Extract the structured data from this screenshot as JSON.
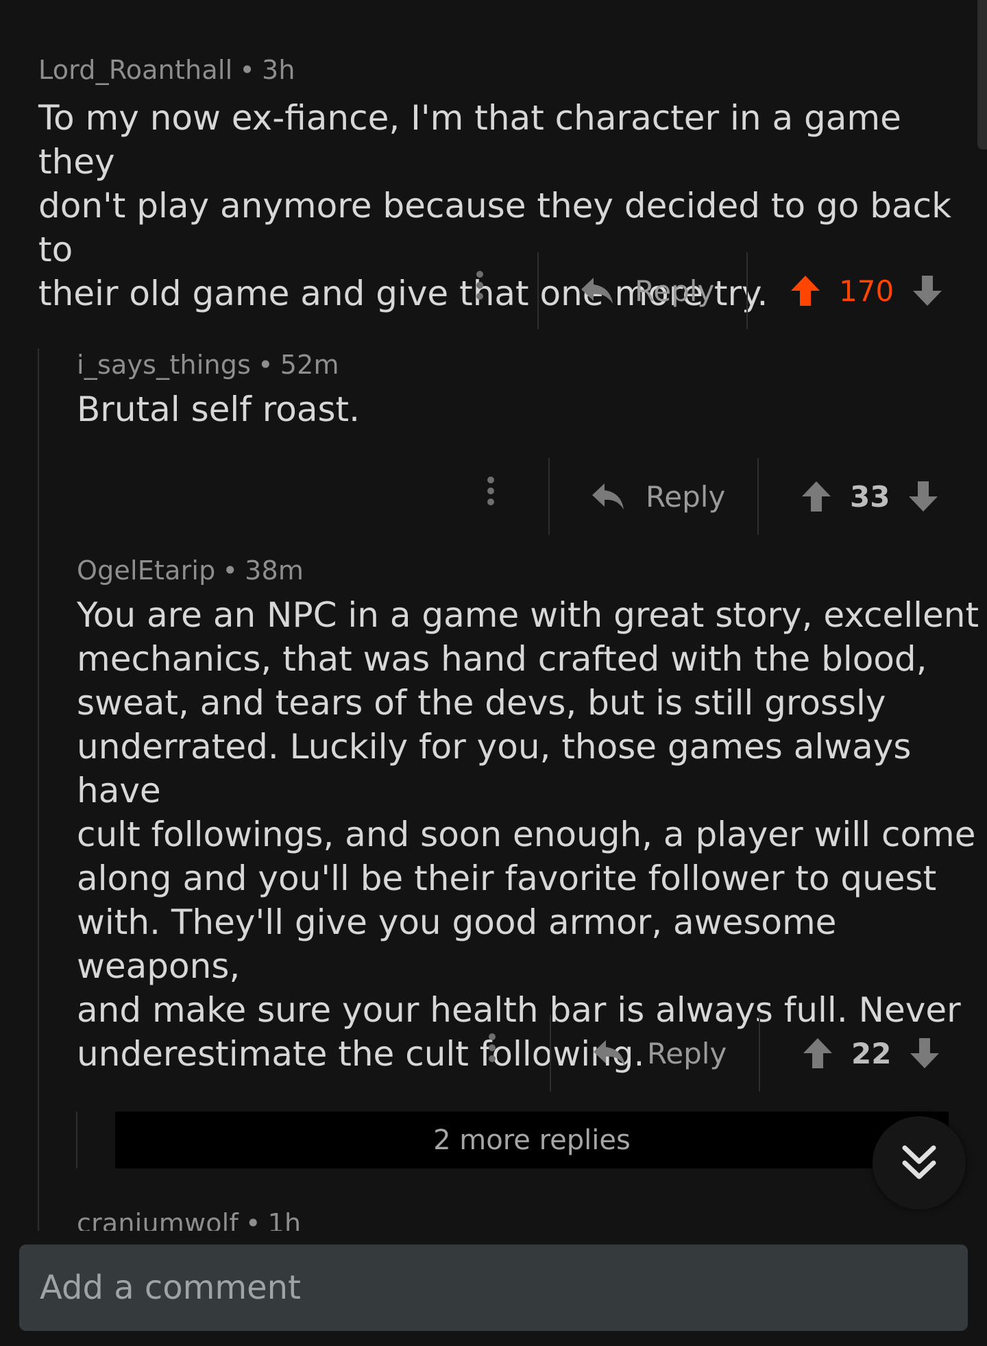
{
  "comments": [
    {
      "author": "Lord_Roanthall",
      "time": "3h",
      "body_lines": [
        "To my now ex-fiance, I'm that character in a game they",
        "don't play anymore because they decided to go back to",
        "their old game and give that one more try."
      ],
      "reply_label": "Reply",
      "score": "170",
      "upvoted": true
    },
    {
      "author": "i_says_things",
      "time": "52m",
      "body_lines": [
        "Brutal self roast."
      ],
      "reply_label": "Reply",
      "score": "33",
      "upvoted": false
    },
    {
      "author": "OgelEtarip",
      "time": "38m",
      "body_lines": [
        "You are an NPC in a game with great story, excellent",
        "mechanics, that was hand crafted with the blood,",
        "sweat, and tears of the devs, but is still grossly",
        "underrated. Luckily for you, those games always have",
        "cult followings, and soon enough, a player will come",
        "along and you'll be their favorite follower to quest",
        "with. They'll give you good armor, awesome weapons,",
        "and make sure your health bar is always full. Never",
        "underestimate the cult following."
      ],
      "reply_label": "Reply",
      "score": "22",
      "upvoted": false
    }
  ],
  "more_replies_label": "2 more replies",
  "partial_comment": {
    "author": "craniumwolf",
    "time": "1h"
  },
  "separator": "•",
  "composer": {
    "placeholder": "Add a comment"
  },
  "icons": [
    "more-vertical-icon",
    "reply-arrow-icon",
    "upvote-arrow-icon",
    "downvote-arrow-icon",
    "double-chevron-down-icon"
  ],
  "colors": {
    "background": "#131313",
    "upvote_active": "#ff4500",
    "composer_bg": "#353a3d"
  }
}
